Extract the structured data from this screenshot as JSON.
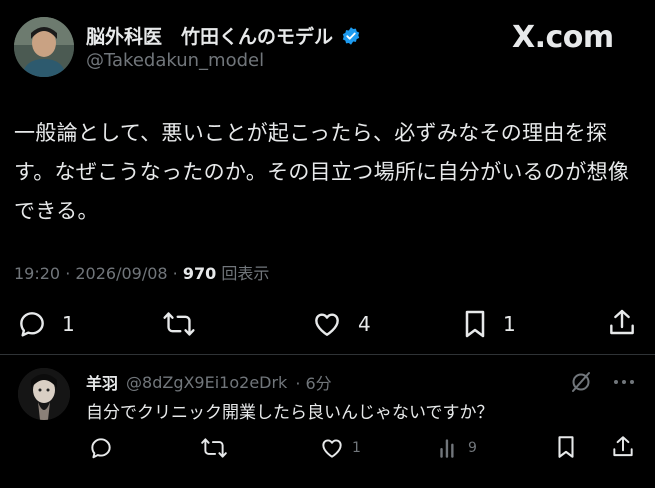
{
  "author": {
    "display_name": "脳外科医　竹田くんのモデル",
    "handle": "@Takedakun_model"
  },
  "brand": {
    "logo_text": "X.com"
  },
  "tweet": {
    "text": "一般論として、悪いことが起こったら、必ずみなその理由を探す。なぜこうなったのか。その目立つ場所に自分がいるのが想像できる。",
    "timestamp": "19:20 · 2026/09/08 · ",
    "views_count": "970",
    "views_label": " 回表示"
  },
  "actions": {
    "replies": "1",
    "retweets": "",
    "likes": "4",
    "bookmarks": "1"
  },
  "reply": {
    "name": "羊羽",
    "handle": "@8dZgX9Ei1o2eDrk",
    "time": "· 6分",
    "text": "自分でクリニック開業したら良いんじゃないですか？",
    "likes": "1",
    "views": "9"
  },
  "colors": {
    "background": "#000000",
    "text": "#e7e9ea",
    "muted": "#71767b",
    "verified": "#1d9bf0"
  },
  "icons": [
    "verified-badge-icon",
    "reply-icon",
    "retweet-icon",
    "like-icon",
    "bookmark-icon",
    "share-icon",
    "grok-icon",
    "more-icon",
    "views-icon"
  ]
}
